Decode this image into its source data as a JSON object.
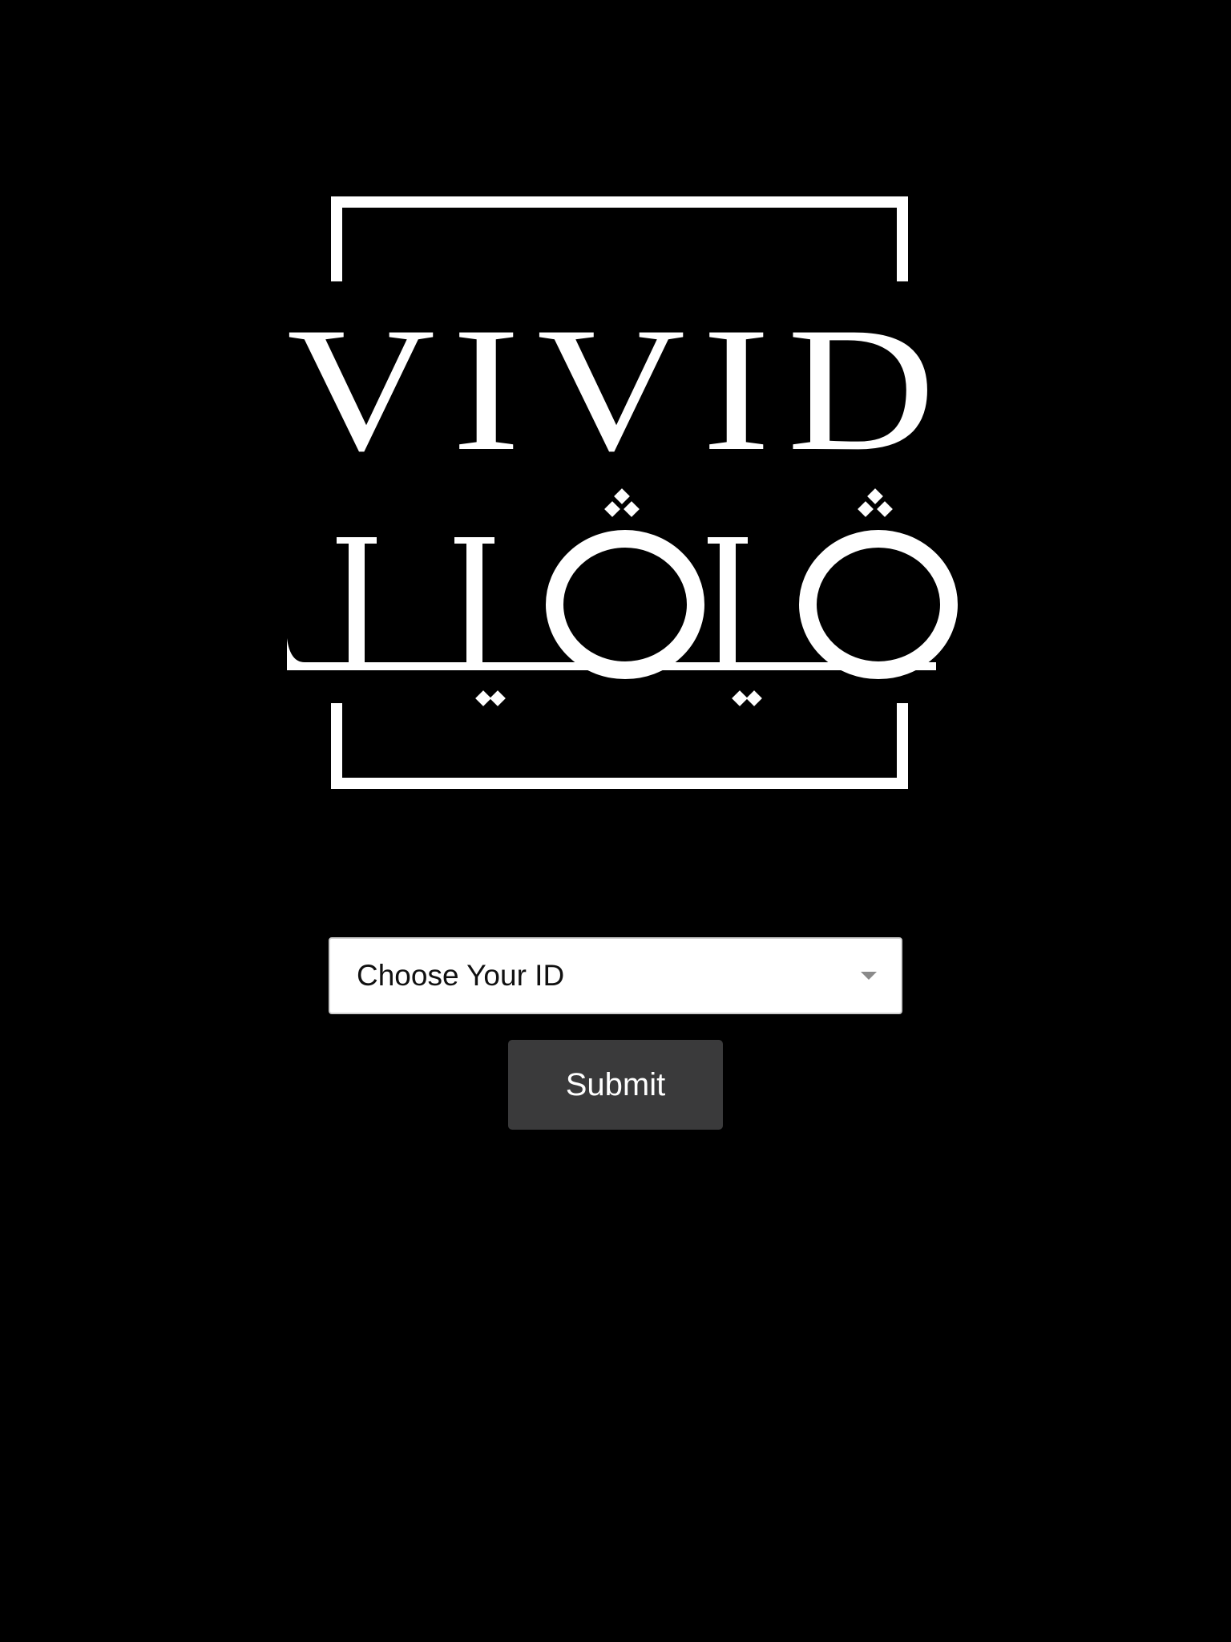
{
  "logo": {
    "latin_wordmark": "VIVID",
    "arabic_wordmark": "فيفيد",
    "color": "#ffffff"
  },
  "form": {
    "id_select": {
      "selected_value": "Choose Your ID",
      "icon": "chevron-down-icon"
    },
    "submit_label": "Submit"
  },
  "colors": {
    "background": "#000000",
    "button_background": "#3a3a3b",
    "button_text": "#ffffff",
    "select_background": "#ffffff"
  }
}
